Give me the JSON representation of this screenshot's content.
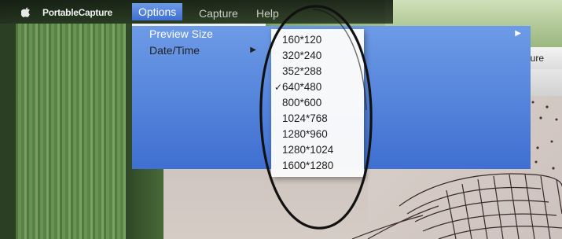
{
  "menubar": {
    "app_name": "PortableCapture",
    "menus": [
      "Options",
      "Capture",
      "Help"
    ]
  },
  "options_menu": {
    "items": [
      {
        "label": "Preview Size",
        "arrow": "▶"
      },
      {
        "label": "Date/Time",
        "arrow": "▶"
      }
    ]
  },
  "preview_size_menu": {
    "check_mark": "✓",
    "selected": "640*480",
    "items": [
      "160*120",
      "320*240",
      "352*288",
      "640*480",
      "800*600",
      "1024*768",
      "1280*960",
      "1280*1024",
      "1600*1280"
    ]
  },
  "window": {
    "title": "MicroCapture",
    "toolbar_icons": [
      "camera-icon",
      "photo-icon"
    ]
  },
  "colors": {
    "selection_blue": "#3f6fd1",
    "annotation": "#111111"
  }
}
